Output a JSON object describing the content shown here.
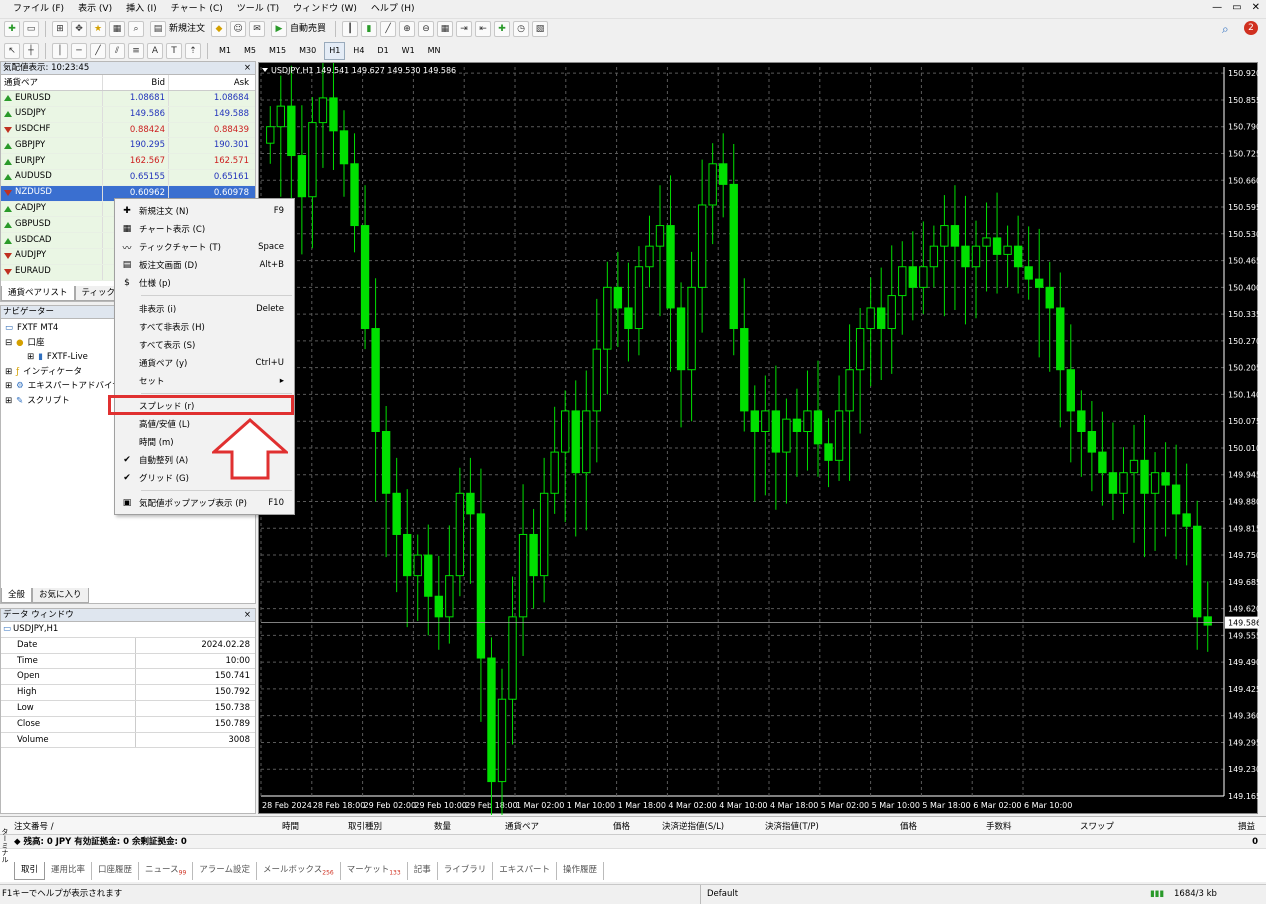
{
  "menu": [
    "ファイル (F)",
    "表示 (V)",
    "挿入 (I)",
    "チャート (C)",
    "ツール (T)",
    "ウィンドウ (W)",
    "ヘルプ (H)"
  ],
  "window_controls": [
    "—",
    "▭",
    "✕"
  ],
  "toolbar": {
    "new_order": "新規注文",
    "auto_trade": "自動売買"
  },
  "notification_count": "2",
  "timeframes": [
    "M1",
    "M5",
    "M15",
    "M30",
    "H1",
    "H4",
    "D1",
    "W1",
    "MN"
  ],
  "market_watch": {
    "title": "気配値表示: 10:23:45",
    "close": "×",
    "col_symbol": "通貨ペア",
    "col_bid": "Bid",
    "col_ask": "Ask",
    "rows": [
      {
        "symbol": "EURUSD",
        "bid": "1.08681",
        "ask": "1.08684",
        "dir": "up",
        "color": "blue"
      },
      {
        "symbol": "USDJPY",
        "bid": "149.586",
        "ask": "149.588",
        "dir": "up",
        "color": "blue"
      },
      {
        "symbol": "USDCHF",
        "bid": "0.88424",
        "ask": "0.88439",
        "dir": "down",
        "color": "red"
      },
      {
        "symbol": "GBPJPY",
        "bid": "190.295",
        "ask": "190.301",
        "dir": "up",
        "color": "blue"
      },
      {
        "symbol": "EURJPY",
        "bid": "162.567",
        "ask": "162.571",
        "dir": "up",
        "color": "red"
      },
      {
        "symbol": "AUDUSD",
        "bid": "0.65155",
        "ask": "0.65161",
        "dir": "up",
        "color": "blue"
      },
      {
        "symbol": "NZDUSD",
        "bid": "0.60962",
        "ask": "0.60978",
        "dir": "down",
        "color": "sel"
      },
      {
        "symbol": "CADJPY",
        "bid": "",
        "ask": "",
        "dir": "up",
        "color": "blue"
      },
      {
        "symbol": "GBPUSD",
        "bid": "",
        "ask": "",
        "dir": "up",
        "color": "blue"
      },
      {
        "symbol": "USDCAD",
        "bid": "",
        "ask": "",
        "dir": "up",
        "color": "blue"
      },
      {
        "symbol": "AUDJPY",
        "bid": "",
        "ask": "",
        "dir": "down",
        "color": "blue"
      },
      {
        "symbol": "EURAUD",
        "bid": "",
        "ask": "",
        "dir": "down",
        "color": "blue"
      }
    ],
    "tabs": [
      "通貨ペアリスト",
      "ティックチ"
    ]
  },
  "navigator": {
    "title": "ナビゲーター",
    "close": "×",
    "items": [
      "FXTF MT4",
      "口座",
      "FXTF-Live",
      "インディケータ",
      "エキスパートアドバイザ",
      "スクリプト"
    ],
    "tabs": [
      "全般",
      "お気に入り"
    ]
  },
  "data_window": {
    "title": "データ ウィンドウ",
    "close": "×",
    "symbol": "USDJPY,H1",
    "rows": [
      {
        "k": "Date",
        "v": "2024.02.28"
      },
      {
        "k": "Time",
        "v": "10:00"
      },
      {
        "k": "Open",
        "v": "150.741"
      },
      {
        "k": "High",
        "v": "150.792"
      },
      {
        "k": "Low",
        "v": "150.738"
      },
      {
        "k": "Close",
        "v": "150.789"
      },
      {
        "k": "Volume",
        "v": "3008"
      }
    ]
  },
  "context_menu": [
    {
      "label": "新規注文 (N)",
      "shortcut": "F9",
      "icon": "new-order-icon",
      "glyph": "✚"
    },
    {
      "label": "チャート表示 (C)",
      "shortcut": "",
      "icon": "chart-icon",
      "glyph": "▦"
    },
    {
      "label": "ティックチャート (T)",
      "shortcut": "Space",
      "icon": "tick-chart-icon",
      "glyph": "〰"
    },
    {
      "label": "板注文画面 (D)",
      "shortcut": "Alt+B",
      "icon": "depth-icon",
      "glyph": "▤"
    },
    {
      "label": "仕様 (p)",
      "shortcut": "",
      "icon": "spec-icon",
      "glyph": "$"
    },
    {
      "sep": true
    },
    {
      "label": "非表示 (i)",
      "shortcut": "Delete",
      "icon": "",
      "glyph": ""
    },
    {
      "label": "すべて非表示 (H)",
      "shortcut": "",
      "icon": "",
      "glyph": ""
    },
    {
      "label": "すべて表示 (S)",
      "shortcut": "",
      "icon": "",
      "glyph": ""
    },
    {
      "label": "通貨ペア (y)",
      "shortcut": "Ctrl+U",
      "icon": "",
      "glyph": ""
    },
    {
      "label": "セット",
      "shortcut": "▸",
      "icon": "",
      "glyph": ""
    },
    {
      "sep": true
    },
    {
      "label": "スプレッド (r)",
      "shortcut": "",
      "icon": "",
      "glyph": "",
      "highlight": true
    },
    {
      "label": "高値/安値 (L)",
      "shortcut": "",
      "icon": "",
      "glyph": ""
    },
    {
      "label": "時間 (m)",
      "shortcut": "",
      "icon": "",
      "glyph": ""
    },
    {
      "label": "自動整列 (A)",
      "shortcut": "",
      "icon": "check-icon",
      "glyph": "✔"
    },
    {
      "label": "グリッド (G)",
      "shortcut": "",
      "icon": "check-icon",
      "glyph": "✔"
    },
    {
      "sep": true
    },
    {
      "label": "気配値ポップアップ表示 (P)",
      "shortcut": "F10",
      "icon": "popup-icon",
      "glyph": "▣"
    }
  ],
  "chart": {
    "header": "USDJPY,H1  149.541 149.627 149.530 149.586",
    "current_price": "149.586",
    "ylabels": [
      "150.920",
      "150.855",
      "150.790",
      "150.725",
      "150.660",
      "150.595",
      "150.530",
      "150.465",
      "150.400",
      "150.335",
      "150.270",
      "150.205",
      "150.140",
      "150.075",
      "150.010",
      "149.945",
      "149.880",
      "149.815",
      "149.750",
      "149.685",
      "149.620",
      "149.555",
      "149.490",
      "149.425",
      "149.360",
      "149.295",
      "149.230",
      "149.165"
    ],
    "xlabels": [
      "28 Feb 2024",
      "28 Feb 18:00",
      "29 Feb 02:00",
      "29 Feb 10:00",
      "29 Feb 18:00",
      "1 Mar 02:00",
      "1 Mar 10:00",
      "1 Mar 18:00",
      "4 Mar 02:00",
      "4 Mar 10:00",
      "4 Mar 18:00",
      "5 Mar 02:00",
      "5 Mar 10:00",
      "5 Mar 18:00",
      "6 Mar 02:00",
      "6 Mar 10:00"
    ],
    "bull_color": "#00e000",
    "bear_color": "#ffffff",
    "grid_color": "#5a5a5a"
  },
  "chart_data": {
    "type": "candlestick",
    "symbol": "USDJPY,H1",
    "ylim": [
      149.165,
      150.935
    ],
    "grid": true,
    "candles_close": [
      150.79,
      150.84,
      150.72,
      150.62,
      150.8,
      150.86,
      150.78,
      150.7,
      150.55,
      150.3,
      150.05,
      149.9,
      149.8,
      149.7,
      149.75,
      149.65,
      149.6,
      149.7,
      149.9,
      149.85,
      149.5,
      149.2,
      149.4,
      149.6,
      149.8,
      149.7,
      149.9,
      150.0,
      150.1,
      149.95,
      150.1,
      150.25,
      150.4,
      150.35,
      150.3,
      150.45,
      150.5,
      150.55,
      150.35,
      150.2,
      150.4,
      150.6,
      150.7,
      150.65,
      150.3,
      150.1,
      150.05,
      150.1,
      150.0,
      150.08,
      150.05,
      150.1,
      150.02,
      149.98,
      150.1,
      150.2,
      150.3,
      150.35,
      150.3,
      150.38,
      150.45,
      150.4,
      150.45,
      150.5,
      150.55,
      150.5,
      150.45,
      150.5,
      150.52,
      150.48,
      150.5,
      150.45,
      150.42,
      150.4,
      150.35,
      150.2,
      150.1,
      150.05,
      150.0,
      149.95,
      149.9,
      149.95,
      149.98,
      149.9,
      149.95,
      149.92,
      149.85,
      149.82,
      149.6,
      149.58
    ]
  },
  "terminal": {
    "columns": [
      "注文番号 /",
      "時間",
      "取引種別",
      "数量",
      "通貨ペア",
      "価格",
      "決済逆指値(S/L)",
      "決済指値(T/P)",
      "価格",
      "手数料",
      "スワップ",
      "損益"
    ],
    "balance": "残高: 0 JPY  有効証拠金: 0  余剰証拠金: 0",
    "balance_value": "0",
    "tabs": [
      {
        "label": "取引",
        "badge": ""
      },
      {
        "label": "運用比率",
        "badge": ""
      },
      {
        "label": "口座履歴",
        "badge": ""
      },
      {
        "label": "ニュース",
        "badge": "99"
      },
      {
        "label": "アラーム設定",
        "badge": ""
      },
      {
        "label": "メールボックス",
        "badge": "256"
      },
      {
        "label": "マーケット",
        "badge": "133"
      },
      {
        "label": "記事",
        "badge": ""
      },
      {
        "label": "ライブラリ",
        "badge": ""
      },
      {
        "label": "エキスパート",
        "badge": ""
      },
      {
        "label": "操作履歴",
        "badge": ""
      }
    ],
    "side_label": "ターミナル"
  },
  "status": {
    "help": "F1キーでヘルプが表示されます",
    "profile": "Default",
    "traffic": "1684/3 kb"
  }
}
